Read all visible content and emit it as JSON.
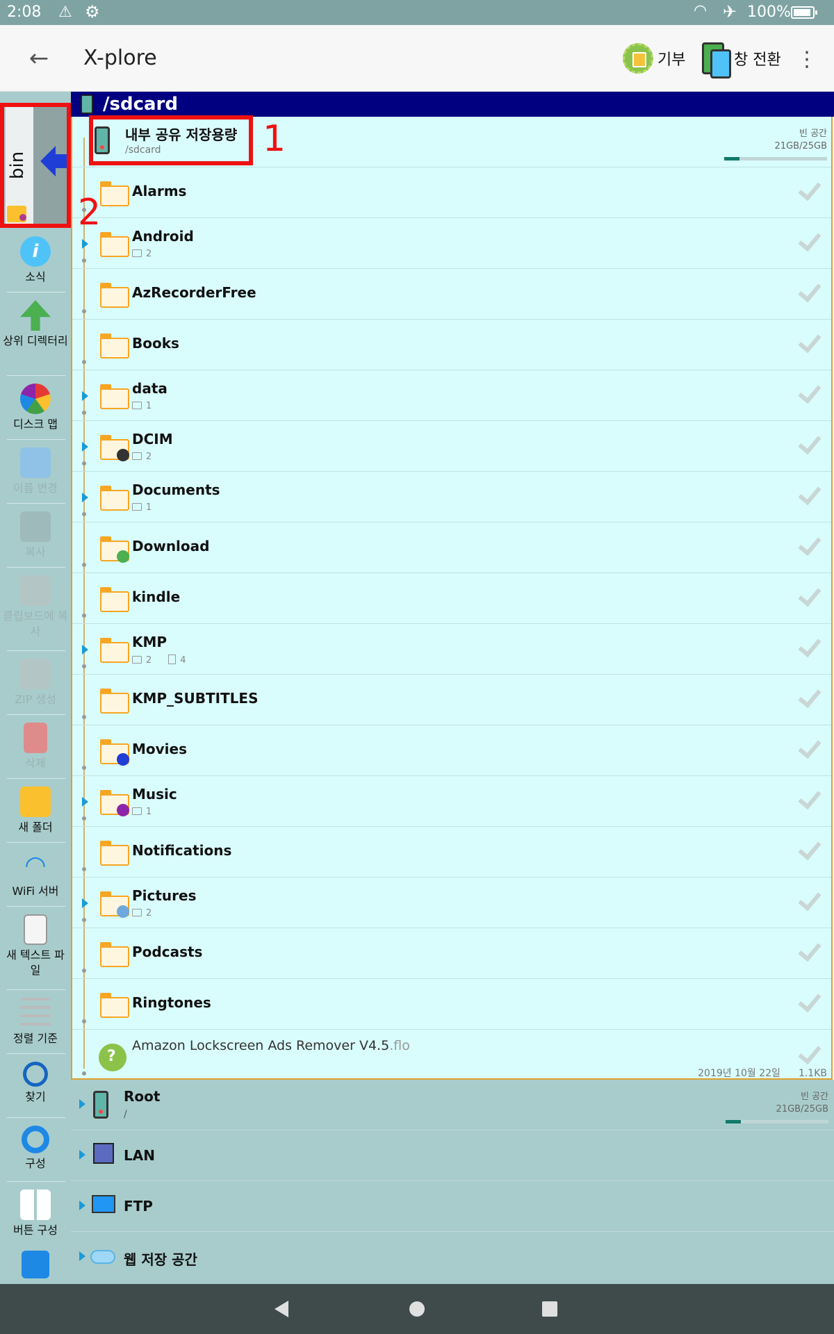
{
  "status_bar": {
    "time": "2:08",
    "battery": "100%"
  },
  "header": {
    "title": "X-plore",
    "donate_label": "기부",
    "switch_label": "창 전환"
  },
  "sidebar": {
    "bin_tab": "bin",
    "tools": [
      {
        "label": "소식",
        "enabled": true
      },
      {
        "label": "상위 디렉터리",
        "enabled": true
      },
      {
        "label": "디스크 맵",
        "enabled": true
      },
      {
        "label": "이름 변경",
        "enabled": false
      },
      {
        "label": "복사",
        "enabled": false
      },
      {
        "label": "클립보드에 복사",
        "enabled": false
      },
      {
        "label": "ZIP 생성",
        "enabled": false
      },
      {
        "label": "삭제",
        "enabled": false
      },
      {
        "label": "새 폴더",
        "enabled": true
      },
      {
        "label": "WiFi 서버",
        "enabled": true
      },
      {
        "label": "새 텍스트 파일",
        "enabled": true
      },
      {
        "label": "정렬 기준",
        "enabled": true
      },
      {
        "label": "찾기",
        "enabled": true
      },
      {
        "label": "구성",
        "enabled": true
      },
      {
        "label": "버튼 구성",
        "enabled": true
      }
    ]
  },
  "path": "/sdcard",
  "storage": {
    "name": "내부 공유 저장용량",
    "path": "/sdcard",
    "free_label": "빈 공간",
    "free_value": "21GB/25GB"
  },
  "folders": [
    {
      "name": "Alarms",
      "sub": ""
    },
    {
      "name": "Android",
      "sub": "2"
    },
    {
      "name": "AzRecorderFree",
      "sub": ""
    },
    {
      "name": "Books",
      "sub": ""
    },
    {
      "name": "data",
      "sub": "1"
    },
    {
      "name": "DCIM",
      "sub": "2"
    },
    {
      "name": "Documents",
      "sub": "1"
    },
    {
      "name": "Download",
      "sub": ""
    },
    {
      "name": "kindle",
      "sub": ""
    },
    {
      "name": "KMP",
      "sub": "2",
      "files": "4"
    },
    {
      "name": "KMP_SUBTITLES",
      "sub": ""
    },
    {
      "name": "Movies",
      "sub": ""
    },
    {
      "name": "Music",
      "sub": "1"
    },
    {
      "name": "Notifications",
      "sub": ""
    },
    {
      "name": "Pictures",
      "sub": "2"
    },
    {
      "name": "Podcasts",
      "sub": ""
    },
    {
      "name": "Ringtones",
      "sub": ""
    }
  ],
  "file": {
    "name": "Amazon Lockscreen Ads Remover V4.5",
    "ext": ".flo",
    "date": "2019년 10월 22일",
    "size": "1.1KB"
  },
  "other_storages": {
    "root": {
      "name": "Root",
      "path": "/",
      "free_label": "빈 공간",
      "free_value": "21GB/25GB"
    },
    "lan": "LAN",
    "ftp": "FTP",
    "web": "웹 저장 공간"
  },
  "annotations": {
    "one": "1",
    "two": "2"
  },
  "colors": {
    "path_bar": "#000080",
    "list_bg": "#d9fcfc",
    "accent_annotation": "#ee1111"
  }
}
